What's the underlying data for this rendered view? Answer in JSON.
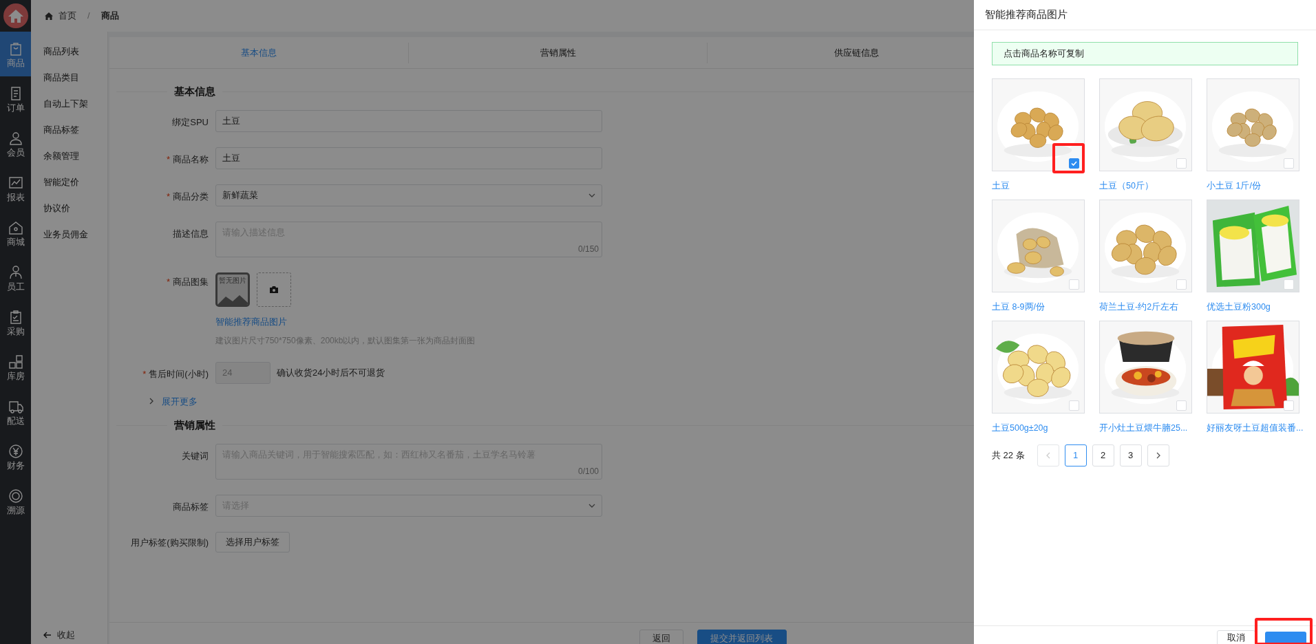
{
  "nav": [
    {
      "label": "商品",
      "selected": true
    },
    {
      "label": "订单",
      "selected": false
    },
    {
      "label": "会员",
      "selected": false
    },
    {
      "label": "报表",
      "selected": false
    },
    {
      "label": "商城",
      "selected": false
    },
    {
      "label": "员工",
      "selected": false
    },
    {
      "label": "采购",
      "selected": false
    },
    {
      "label": "库房",
      "selected": false
    },
    {
      "label": "配送",
      "selected": false
    },
    {
      "label": "财务",
      "selected": false
    },
    {
      "label": "溯源",
      "selected": false
    }
  ],
  "breadcrumb": [
    "首页",
    "商品"
  ],
  "breadcrumb_separator": "/",
  "required_mark": "*",
  "submenu": [
    "商品列表",
    "商品类目",
    "自动上下架",
    "商品标签",
    "余额管理",
    "智能定价",
    "协议价",
    "业务员佣金"
  ],
  "collapse_label": "收起",
  "tabs": [
    {
      "label": "基本信息",
      "selected": true
    },
    {
      "label": "营销属性",
      "selected": false
    },
    {
      "label": "供应链信息",
      "selected": false
    }
  ],
  "sections": [
    {
      "title": "基本信息",
      "fields": [
        {
          "kind": "text",
          "label": "绑定SPU",
          "required": false,
          "value": "土豆"
        },
        {
          "kind": "text",
          "label": "商品名称",
          "required": true,
          "value": "土豆"
        },
        {
          "kind": "select",
          "label": "商品分类",
          "required": true,
          "value": "新鲜蔬菜"
        },
        {
          "kind": "textarea",
          "label": "描述信息",
          "required": false,
          "placeholder": "请输入描述信息",
          "counter": "0/150"
        },
        {
          "kind": "gallery",
          "label": "商品图集",
          "required": true,
          "empty_text": "暂无图片",
          "link": "智能推荐商品图片",
          "hint": "建议图片尺寸750*750像素、200kb以内，默认图集第一张为商品封面图"
        },
        {
          "kind": "number",
          "label": "售后时间(小时)",
          "required": true,
          "value": "24",
          "disabled": true,
          "note": "确认收货24小时后不可退货"
        }
      ],
      "expand": "展开更多"
    },
    {
      "title": "营销属性",
      "fields": [
        {
          "kind": "textarea",
          "label": "关键词",
          "required": false,
          "placeholder": "请输入商品关键词，用于智能搜索匹配，如：西红柿又名番茄，土豆学名马铃薯",
          "counter": "0/100"
        },
        {
          "kind": "select",
          "label": "商品标签",
          "required": false,
          "placeholder": "请选择"
        },
        {
          "kind": "button",
          "label": "用户标签(购买限制)",
          "required": false,
          "button": "选择用户标签"
        }
      ]
    }
  ],
  "footer_buttons": [
    {
      "label": "返回",
      "kind": "default"
    },
    {
      "label": "提交并返回列表",
      "kind": "primary"
    }
  ],
  "drawer": {
    "title": "智能推荐商品图片",
    "notice": "点击商品名称可复制",
    "items": [
      {
        "name": "土豆",
        "checked": true
      },
      {
        "name": "土豆（50斤）",
        "checked": false
      },
      {
        "name": "小土豆 1斤/份",
        "checked": false
      },
      {
        "name": "土豆 8-9两/份",
        "checked": false
      },
      {
        "name": "荷兰土豆-约2斤左右",
        "checked": false
      },
      {
        "name": "优选土豆粉300g",
        "checked": false
      },
      {
        "name": "土豆500g±20g",
        "checked": false
      },
      {
        "name": "开小灶土豆煨牛腩25...",
        "checked": false
      },
      {
        "name": "好丽友呀土豆超值装番...",
        "checked": false
      }
    ],
    "pagination": {
      "total": "共 22 条",
      "pages": [
        {
          "label": "1",
          "selected": true
        },
        {
          "label": "2",
          "selected": false
        },
        {
          "label": "3",
          "selected": false
        }
      ]
    },
    "buttons": [
      {
        "label": "取消",
        "kind": "default"
      },
      {
        "kind": "primary"
      }
    ]
  }
}
